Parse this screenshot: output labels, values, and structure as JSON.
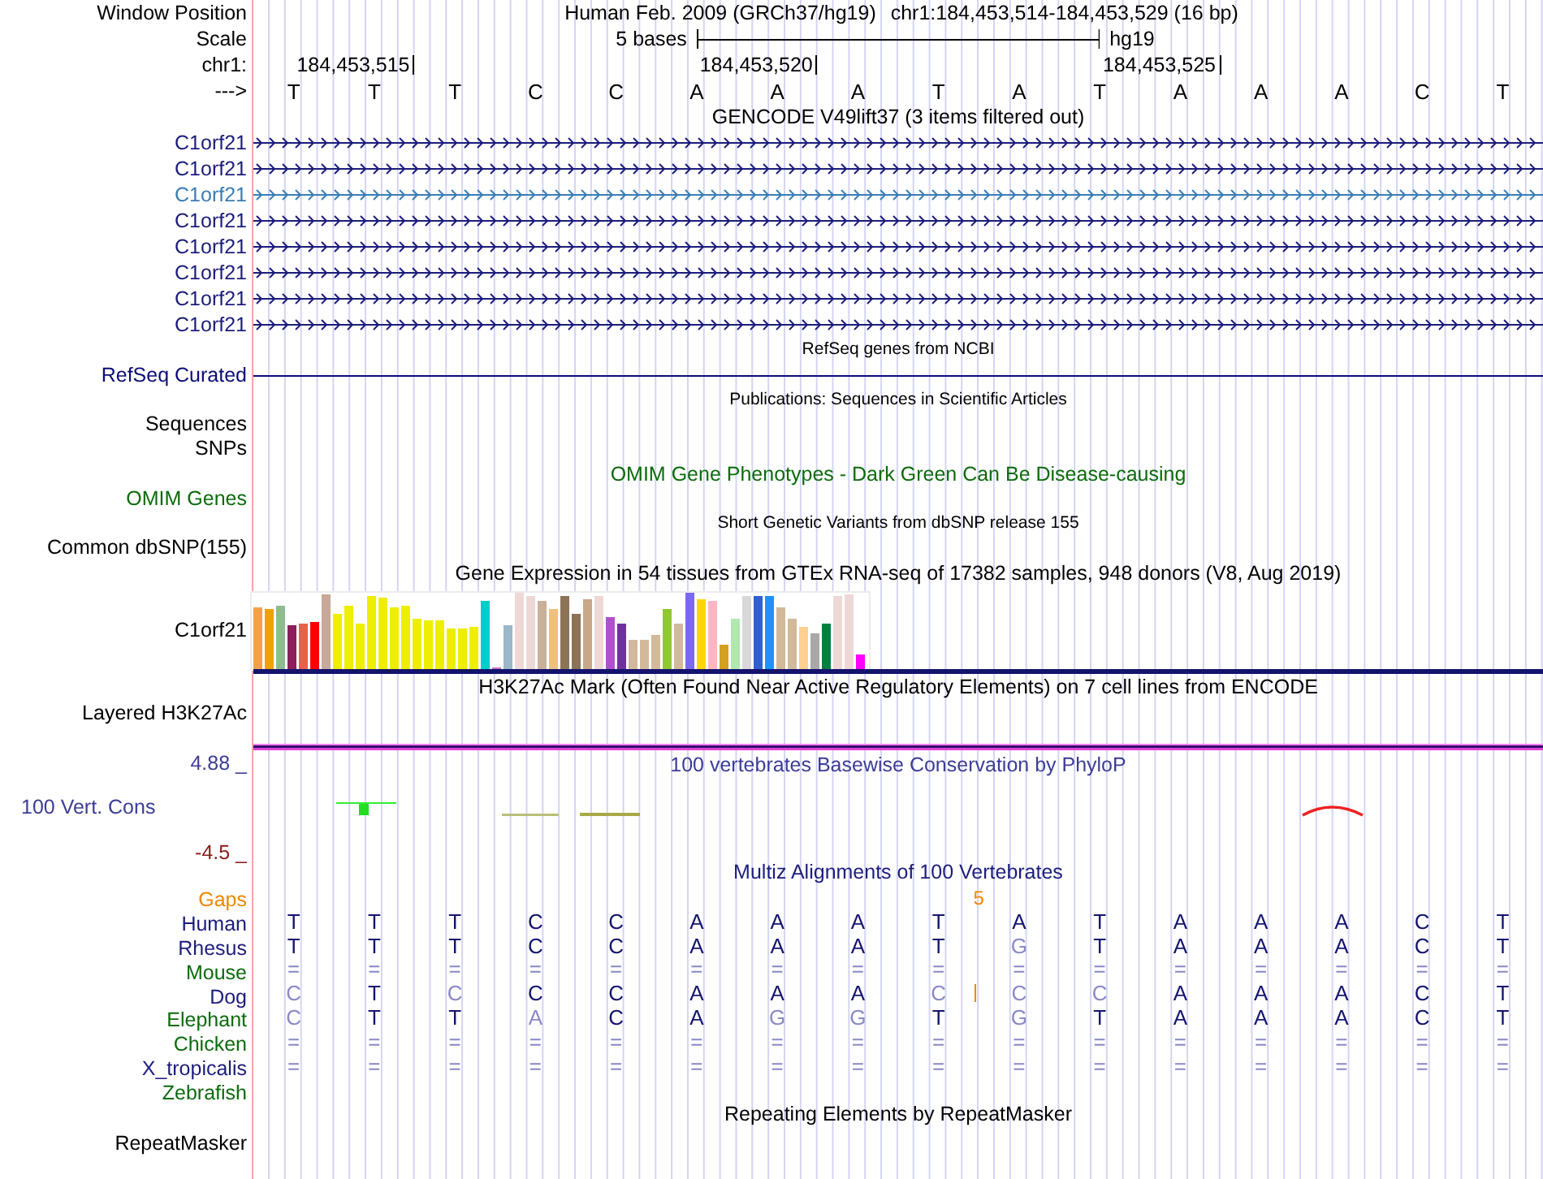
{
  "header": {
    "window_position": {
      "label": "Window Position",
      "assembly": "Human Feb. 2009 (GRCh37/hg19)",
      "range": "chr1:184,453,514-184,453,529 (16 bp)"
    },
    "scale": {
      "label": "Scale",
      "span": "5 bases",
      "assembly": "hg19"
    },
    "ruler": {
      "label": "chr1:",
      "ticks": [
        "184,453,515",
        "184,453,520",
        "184,453,525"
      ]
    },
    "sequence": {
      "label": "--->",
      "bases": [
        "T",
        "T",
        "T",
        "C",
        "C",
        "A",
        "A",
        "A",
        "T",
        "A",
        "T",
        "A",
        "A",
        "A",
        "C",
        "T"
      ]
    }
  },
  "tracks": [
    {
      "kind": "title",
      "text": "GENCODE V49lift37 (3 items filtered out)",
      "color": "#000000"
    },
    {
      "kind": "gene",
      "label": "C1orf21",
      "color": "#1c1c7c"
    },
    {
      "kind": "gene",
      "label": "C1orf21",
      "color": "#1c1c7c"
    },
    {
      "kind": "gene",
      "label": "C1orf21",
      "color": "#3a7db4"
    },
    {
      "kind": "gene",
      "label": "C1orf21",
      "color": "#1c1c7c"
    },
    {
      "kind": "gene",
      "label": "C1orf21",
      "color": "#1c1c7c"
    },
    {
      "kind": "gene",
      "label": "C1orf21",
      "color": "#1c1c7c"
    },
    {
      "kind": "gene",
      "label": "C1orf21",
      "color": "#1c1c7c"
    },
    {
      "kind": "gene",
      "label": "C1orf21",
      "color": "#1c1c7c"
    },
    {
      "kind": "note",
      "text": "RefSeq genes from NCBI",
      "color": "#000000"
    },
    {
      "kind": "line",
      "label": "RefSeq Curated",
      "color": "#0c0c78"
    },
    {
      "kind": "note",
      "text": "Publications: Sequences in Scientific Articles",
      "color": "#000000"
    },
    {
      "kind": "label",
      "label": "Sequences",
      "color": "#000000"
    },
    {
      "kind": "label",
      "label": "SNPs",
      "color": "#000000"
    },
    {
      "kind": "title",
      "text": "OMIM Gene Phenotypes - Dark Green Can Be Disease-causing",
      "color": "#0b6b0b"
    },
    {
      "kind": "label",
      "label": "OMIM Genes",
      "color": "#0b6b0b"
    },
    {
      "kind": "note",
      "text": "Short Genetic Variants from dbSNP release 155",
      "color": "#000000"
    },
    {
      "kind": "label",
      "label": "Common dbSNP(155)",
      "color": "#000000"
    },
    {
      "kind": "title",
      "text": "Gene Expression in 54 tissues from GTEx RNA-seq of 17382 samples, 948 donors (V8, Aug 2019)",
      "color": "#000000"
    },
    {
      "kind": "bars",
      "label": "C1orf21",
      "color": "#000000"
    },
    {
      "kind": "title",
      "text": "H3K27Ac Mark (Often Found Near Active Regulatory Elements) on 7 cell lines from ENCODE",
      "color": "#000000"
    },
    {
      "kind": "layered",
      "label": "Layered H3K27Ac",
      "color": "#000000"
    },
    {
      "kind": "wiggle",
      "title": "100 vertebrates Basewise Conservation by PhyloP",
      "label": "100 Vert. Cons",
      "max": "4.88 _",
      "min": "-4.5 _",
      "color": "#3c3c96"
    },
    {
      "kind": "title",
      "text": "Multiz Alignments of 100 Vertebrates",
      "color": "#1c1c7c"
    },
    {
      "kind": "gaps",
      "label": "Gaps",
      "text": "5",
      "color": "#ee8800"
    },
    {
      "kind": "align",
      "label": "Human",
      "color": "#1c1c7c",
      "bases": [
        {
          "b": "T",
          "faded": false
        },
        {
          "b": "T",
          "faded": false
        },
        {
          "b": "T",
          "faded": false
        },
        {
          "b": "C",
          "faded": false
        },
        {
          "b": "C",
          "faded": false
        },
        {
          "b": "A",
          "faded": false
        },
        {
          "b": "A",
          "faded": false
        },
        {
          "b": "A",
          "faded": false
        },
        {
          "b": "T",
          "faded": false
        },
        {
          "b": "A",
          "faded": false
        },
        {
          "b": "T",
          "faded": false
        },
        {
          "b": "A",
          "faded": false
        },
        {
          "b": "A",
          "faded": false
        },
        {
          "b": "A",
          "faded": false
        },
        {
          "b": "C",
          "faded": false
        },
        {
          "b": "T",
          "faded": false
        }
      ]
    },
    {
      "kind": "align",
      "label": "Rhesus",
      "color": "#1c1c7c",
      "bases": [
        {
          "b": "T",
          "faded": false
        },
        {
          "b": "T",
          "faded": false
        },
        {
          "b": "T",
          "faded": false
        },
        {
          "b": "C",
          "faded": false
        },
        {
          "b": "C",
          "faded": false
        },
        {
          "b": "A",
          "faded": false
        },
        {
          "b": "A",
          "faded": false
        },
        {
          "b": "A",
          "faded": false
        },
        {
          "b": "T",
          "faded": false
        },
        {
          "b": "G",
          "faded": true
        },
        {
          "b": "T",
          "faded": false
        },
        {
          "b": "A",
          "faded": false
        },
        {
          "b": "A",
          "faded": false
        },
        {
          "b": "A",
          "faded": false
        },
        {
          "b": "C",
          "faded": false
        },
        {
          "b": "T",
          "faded": false
        }
      ]
    },
    {
      "kind": "align",
      "label": "Mouse",
      "color": "#0b6b0b",
      "bases": [
        {
          "b": "=",
          "faded": true
        },
        {
          "b": "=",
          "faded": true
        },
        {
          "b": "=",
          "faded": true
        },
        {
          "b": "=",
          "faded": true
        },
        {
          "b": "=",
          "faded": true
        },
        {
          "b": "=",
          "faded": true
        },
        {
          "b": "=",
          "faded": true
        },
        {
          "b": "=",
          "faded": true
        },
        {
          "b": "=",
          "faded": true
        },
        {
          "b": "=",
          "faded": true
        },
        {
          "b": "=",
          "faded": true
        },
        {
          "b": "=",
          "faded": true
        },
        {
          "b": "=",
          "faded": true
        },
        {
          "b": "=",
          "faded": true
        },
        {
          "b": "=",
          "faded": true
        },
        {
          "b": "=",
          "faded": true
        }
      ]
    },
    {
      "kind": "align",
      "label": "Dog",
      "color": "#1c1c7c",
      "bases": [
        {
          "b": "C",
          "faded": true
        },
        {
          "b": "T",
          "faded": false
        },
        {
          "b": "C",
          "faded": true
        },
        {
          "b": "C",
          "faded": false
        },
        {
          "b": "C",
          "faded": false
        },
        {
          "b": "A",
          "faded": false
        },
        {
          "b": "A",
          "faded": false
        },
        {
          "b": "A",
          "faded": false
        },
        {
          "b": "C",
          "faded": true
        },
        {
          "kind": "insert"
        },
        {
          "b": "C",
          "faded": true
        },
        {
          "b": "C",
          "faded": true
        },
        {
          "b": "A",
          "faded": false
        },
        {
          "b": "A",
          "faded": false
        },
        {
          "b": "A",
          "faded": false
        },
        {
          "b": "C",
          "faded": false
        },
        {
          "b": "T",
          "faded": false
        }
      ]
    },
    {
      "kind": "align",
      "label": "Elephant",
      "color": "#0b6b0b",
      "bases": [
        {
          "b": "C",
          "faded": true
        },
        {
          "b": "T",
          "faded": false
        },
        {
          "b": "T",
          "faded": false
        },
        {
          "b": "A",
          "faded": true
        },
        {
          "b": "C",
          "faded": false
        },
        {
          "b": "A",
          "faded": false
        },
        {
          "b": "G",
          "faded": true
        },
        {
          "b": "G",
          "faded": true
        },
        {
          "b": "T",
          "faded": false
        },
        {
          "b": "G",
          "faded": true
        },
        {
          "b": "T",
          "faded": false
        },
        {
          "b": "A",
          "faded": false
        },
        {
          "b": "A",
          "faded": false
        },
        {
          "b": "A",
          "faded": false
        },
        {
          "b": "C",
          "faded": false
        },
        {
          "b": "T",
          "faded": false
        }
      ]
    },
    {
      "kind": "align",
      "label": "Chicken",
      "color": "#0b6b0b",
      "bases": [
        {
          "b": "=",
          "faded": true
        },
        {
          "b": "=",
          "faded": true
        },
        {
          "b": "=",
          "faded": true
        },
        {
          "b": "=",
          "faded": true
        },
        {
          "b": "=",
          "faded": true
        },
        {
          "b": "=",
          "faded": true
        },
        {
          "b": "=",
          "faded": true
        },
        {
          "b": "=",
          "faded": true
        },
        {
          "b": "=",
          "faded": true
        },
        {
          "b": "=",
          "faded": true
        },
        {
          "b": "=",
          "faded": true
        },
        {
          "b": "=",
          "faded": true
        },
        {
          "b": "=",
          "faded": true
        },
        {
          "b": "=",
          "faded": true
        },
        {
          "b": "=",
          "faded": true
        },
        {
          "b": "=",
          "faded": true
        }
      ]
    },
    {
      "kind": "align",
      "label": "X_tropicalis",
      "color": "#1c1c7c",
      "bases": [
        {
          "b": "=",
          "faded": true
        },
        {
          "b": "=",
          "faded": true
        },
        {
          "b": "=",
          "faded": true
        },
        {
          "b": "=",
          "faded": true
        },
        {
          "b": "=",
          "faded": true
        },
        {
          "b": "=",
          "faded": true
        },
        {
          "b": "=",
          "faded": true
        },
        {
          "b": "=",
          "faded": true
        },
        {
          "b": "=",
          "faded": true
        },
        {
          "b": "=",
          "faded": true
        },
        {
          "b": "=",
          "faded": true
        },
        {
          "b": "=",
          "faded": true
        },
        {
          "b": "=",
          "faded": true
        },
        {
          "b": "=",
          "faded": true
        },
        {
          "b": "=",
          "faded": true
        },
        {
          "b": "=",
          "faded": true
        }
      ]
    },
    {
      "kind": "align",
      "label": "Zebrafish",
      "color": "#0b6b0b"
    },
    {
      "kind": "title",
      "text": "Repeating Elements by RepeatMasker",
      "color": "#000000"
    },
    {
      "kind": "label",
      "label": "RepeatMasker",
      "color": "#000000"
    }
  ]
}
